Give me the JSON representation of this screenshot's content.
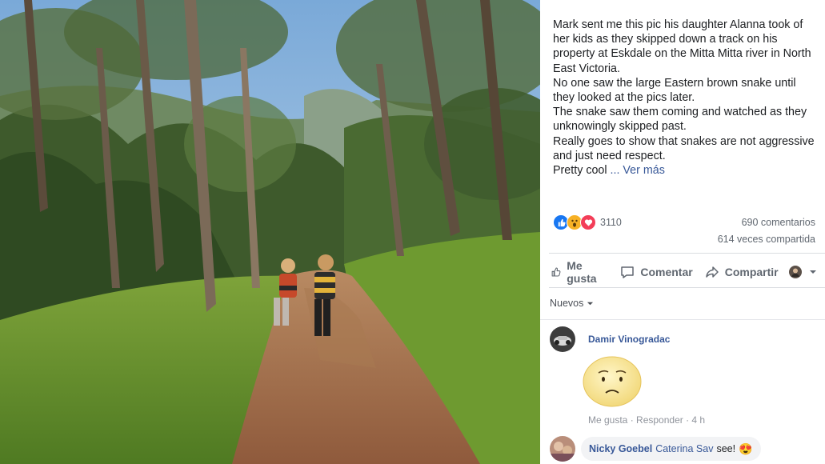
{
  "post": {
    "lines": [
      "Mark sent me this pic his daughter Alanna took of her kids as they skipped down a track on his property at Eskdale on the Mitta Mitta river in North East Victoria.",
      "No one saw the large Eastern brown snake until they looked at the pics later.",
      "The snake saw them coming and watched as they unknowingly skipped past.",
      "Really goes to show that snakes are not aggressive and just need respect."
    ],
    "last_line": "Pretty cool ",
    "see_more": "... Ver más"
  },
  "stats": {
    "reactions_count": "3110",
    "reaction_icons": [
      "like-icon",
      "wow-icon",
      "love-icon"
    ],
    "comments": "690 comentarios",
    "shares": "614 veces compartida"
  },
  "actions": {
    "like": "Me gusta",
    "comment": "Comentar",
    "share": "Compartir"
  },
  "sort": {
    "label": "Nuevos"
  },
  "comments": [
    {
      "name": "Damir Vinogradac",
      "sticker": "sad-face-sticker",
      "like": "Me gusta",
      "sep1": " · ",
      "reply": "Responder",
      "sep2": " · ",
      "time": "4 h"
    },
    {
      "name": "Nicky Goebel",
      "tag": "Caterina Sav",
      "text": "see!",
      "emoji": "😍"
    }
  ],
  "colors": {
    "link": "#385898",
    "like_blue": "#1877f2",
    "love_red": "#f33e58",
    "wow_yellow": "#f7b125",
    "secondary_text": "#606770"
  }
}
